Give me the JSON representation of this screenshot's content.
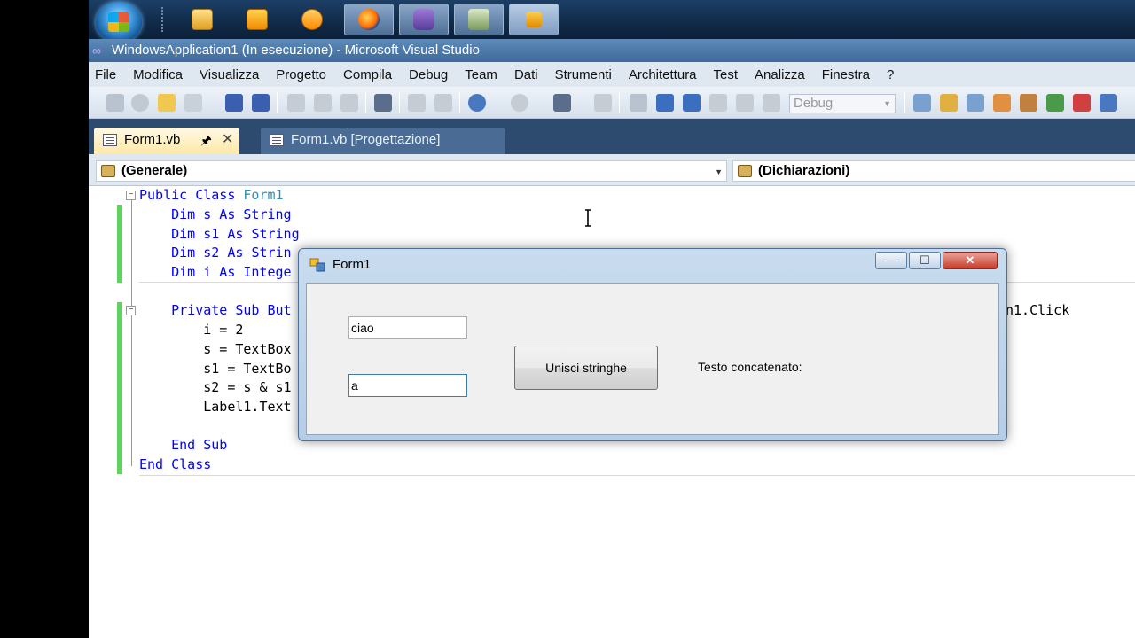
{
  "window_title": "WindowsApplication1 (In esecuzione) - Microsoft Visual Studio",
  "menu": [
    "File",
    "Modifica",
    "Visualizza",
    "Progetto",
    "Compila",
    "Debug",
    "Team",
    "Dati",
    "Strumenti",
    "Architettura",
    "Test",
    "Analizza",
    "Finestra",
    "?"
  ],
  "toolbar": {
    "config_combo": "Debug"
  },
  "tabs": [
    {
      "label": "Form1.vb",
      "active": true
    },
    {
      "label": "Form1.vb [Progettazione]",
      "active": false
    }
  ],
  "nav": {
    "left": "(Generale)",
    "right": "(Dichiarazioni)"
  },
  "code": {
    "l1": [
      "Public Class ",
      "Form1"
    ],
    "l2": [
      "    Dim s As ",
      "String"
    ],
    "l3": [
      "    Dim s1 As ",
      "String"
    ],
    "l4": [
      "    Dim s2 As ",
      "Strin"
    ],
    "l5": [
      "    Dim i As ",
      "Intege"
    ],
    "l6_start": "    Private Sub But",
    "l6_end": "n1.Click",
    "l7": "        i = 2",
    "l8": "        s = TextBox",
    "l9": "        s1 = TextBo",
    "l10": "        s2 = s & s1",
    "l11": "        Label1.Text",
    "l12": "    End Sub",
    "l13": "End Class"
  },
  "form": {
    "title": "Form1",
    "textbox1_value": "ciao",
    "textbox2_value": "a",
    "button_label": "Unisci stringhe",
    "label_text": "Testo concatenato:",
    "minimize_glyph": "—",
    "maximize_glyph": "☐",
    "close_glyph": "✕"
  },
  "icons": [
    "windows-start-icon",
    "explorer-icon",
    "outlook-icon",
    "media-player-icon",
    "firefox-icon",
    "visual-studio-icon",
    "paint-icon",
    "form-app-icon"
  ]
}
